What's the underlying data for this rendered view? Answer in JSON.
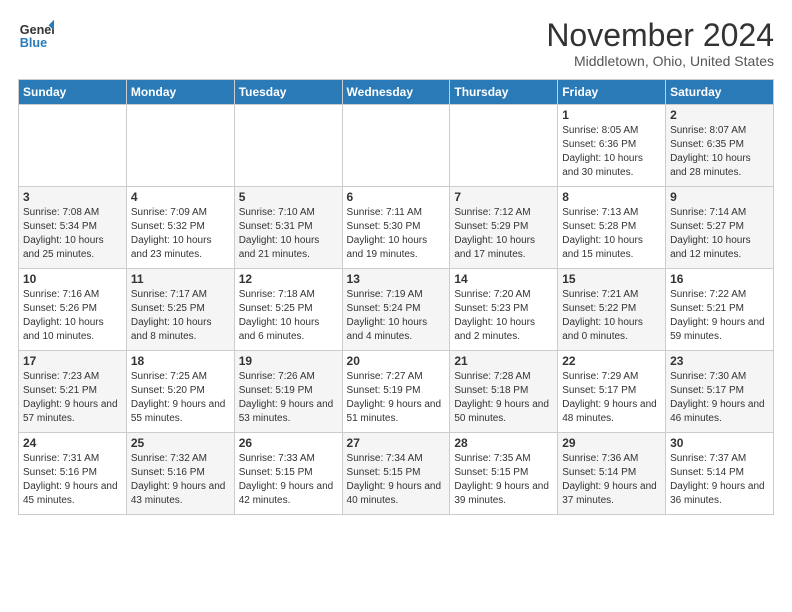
{
  "header": {
    "logo_line1": "General",
    "logo_line2": "Blue",
    "month": "November 2024",
    "location": "Middletown, Ohio, United States"
  },
  "days_of_week": [
    "Sunday",
    "Monday",
    "Tuesday",
    "Wednesday",
    "Thursday",
    "Friday",
    "Saturday"
  ],
  "weeks": [
    [
      {
        "num": "",
        "info": "",
        "bg": "empty"
      },
      {
        "num": "",
        "info": "",
        "bg": "empty"
      },
      {
        "num": "",
        "info": "",
        "bg": "empty"
      },
      {
        "num": "",
        "info": "",
        "bg": "empty"
      },
      {
        "num": "",
        "info": "",
        "bg": "empty"
      },
      {
        "num": "1",
        "info": "Sunrise: 8:05 AM\nSunset: 6:36 PM\nDaylight: 10 hours\nand 30 minutes.",
        "bg": "white"
      },
      {
        "num": "2",
        "info": "Sunrise: 8:07 AM\nSunset: 6:35 PM\nDaylight: 10 hours\nand 28 minutes.",
        "bg": "gray"
      }
    ],
    [
      {
        "num": "3",
        "info": "Sunrise: 7:08 AM\nSunset: 5:34 PM\nDaylight: 10 hours\nand 25 minutes.",
        "bg": "gray"
      },
      {
        "num": "4",
        "info": "Sunrise: 7:09 AM\nSunset: 5:32 PM\nDaylight: 10 hours\nand 23 minutes.",
        "bg": "white"
      },
      {
        "num": "5",
        "info": "Sunrise: 7:10 AM\nSunset: 5:31 PM\nDaylight: 10 hours\nand 21 minutes.",
        "bg": "gray"
      },
      {
        "num": "6",
        "info": "Sunrise: 7:11 AM\nSunset: 5:30 PM\nDaylight: 10 hours\nand 19 minutes.",
        "bg": "white"
      },
      {
        "num": "7",
        "info": "Sunrise: 7:12 AM\nSunset: 5:29 PM\nDaylight: 10 hours\nand 17 minutes.",
        "bg": "gray"
      },
      {
        "num": "8",
        "info": "Sunrise: 7:13 AM\nSunset: 5:28 PM\nDaylight: 10 hours\nand 15 minutes.",
        "bg": "white"
      },
      {
        "num": "9",
        "info": "Sunrise: 7:14 AM\nSunset: 5:27 PM\nDaylight: 10 hours\nand 12 minutes.",
        "bg": "gray"
      }
    ],
    [
      {
        "num": "10",
        "info": "Sunrise: 7:16 AM\nSunset: 5:26 PM\nDaylight: 10 hours\nand 10 minutes.",
        "bg": "white"
      },
      {
        "num": "11",
        "info": "Sunrise: 7:17 AM\nSunset: 5:25 PM\nDaylight: 10 hours\nand 8 minutes.",
        "bg": "gray"
      },
      {
        "num": "12",
        "info": "Sunrise: 7:18 AM\nSunset: 5:25 PM\nDaylight: 10 hours\nand 6 minutes.",
        "bg": "white"
      },
      {
        "num": "13",
        "info": "Sunrise: 7:19 AM\nSunset: 5:24 PM\nDaylight: 10 hours\nand 4 minutes.",
        "bg": "gray"
      },
      {
        "num": "14",
        "info": "Sunrise: 7:20 AM\nSunset: 5:23 PM\nDaylight: 10 hours\nand 2 minutes.",
        "bg": "white"
      },
      {
        "num": "15",
        "info": "Sunrise: 7:21 AM\nSunset: 5:22 PM\nDaylight: 10 hours\nand 0 minutes.",
        "bg": "gray"
      },
      {
        "num": "16",
        "info": "Sunrise: 7:22 AM\nSunset: 5:21 PM\nDaylight: 9 hours\nand 59 minutes.",
        "bg": "white"
      }
    ],
    [
      {
        "num": "17",
        "info": "Sunrise: 7:23 AM\nSunset: 5:21 PM\nDaylight: 9 hours\nand 57 minutes.",
        "bg": "gray"
      },
      {
        "num": "18",
        "info": "Sunrise: 7:25 AM\nSunset: 5:20 PM\nDaylight: 9 hours\nand 55 minutes.",
        "bg": "white"
      },
      {
        "num": "19",
        "info": "Sunrise: 7:26 AM\nSunset: 5:19 PM\nDaylight: 9 hours\nand 53 minutes.",
        "bg": "gray"
      },
      {
        "num": "20",
        "info": "Sunrise: 7:27 AM\nSunset: 5:19 PM\nDaylight: 9 hours\nand 51 minutes.",
        "bg": "white"
      },
      {
        "num": "21",
        "info": "Sunrise: 7:28 AM\nSunset: 5:18 PM\nDaylight: 9 hours\nand 50 minutes.",
        "bg": "gray"
      },
      {
        "num": "22",
        "info": "Sunrise: 7:29 AM\nSunset: 5:17 PM\nDaylight: 9 hours\nand 48 minutes.",
        "bg": "white"
      },
      {
        "num": "23",
        "info": "Sunrise: 7:30 AM\nSunset: 5:17 PM\nDaylight: 9 hours\nand 46 minutes.",
        "bg": "gray"
      }
    ],
    [
      {
        "num": "24",
        "info": "Sunrise: 7:31 AM\nSunset: 5:16 PM\nDaylight: 9 hours\nand 45 minutes.",
        "bg": "white"
      },
      {
        "num": "25",
        "info": "Sunrise: 7:32 AM\nSunset: 5:16 PM\nDaylight: 9 hours\nand 43 minutes.",
        "bg": "gray"
      },
      {
        "num": "26",
        "info": "Sunrise: 7:33 AM\nSunset: 5:15 PM\nDaylight: 9 hours\nand 42 minutes.",
        "bg": "white"
      },
      {
        "num": "27",
        "info": "Sunrise: 7:34 AM\nSunset: 5:15 PM\nDaylight: 9 hours\nand 40 minutes.",
        "bg": "gray"
      },
      {
        "num": "28",
        "info": "Sunrise: 7:35 AM\nSunset: 5:15 PM\nDaylight: 9 hours\nand 39 minutes.",
        "bg": "white"
      },
      {
        "num": "29",
        "info": "Sunrise: 7:36 AM\nSunset: 5:14 PM\nDaylight: 9 hours\nand 37 minutes.",
        "bg": "gray"
      },
      {
        "num": "30",
        "info": "Sunrise: 7:37 AM\nSunset: 5:14 PM\nDaylight: 9 hours\nand 36 minutes.",
        "bg": "white"
      }
    ]
  ]
}
